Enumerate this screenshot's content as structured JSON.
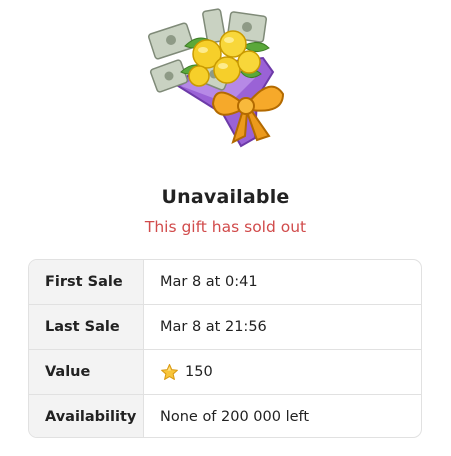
{
  "gift": {
    "icon": "money-flower-bouquet-icon",
    "title": "Unavailable",
    "status": "This gift has sold out"
  },
  "colors": {
    "status_text": "#d14b4b",
    "label_background": "#f3f3f3",
    "border": "#e1e1e1"
  },
  "details": {
    "rows": [
      {
        "label": "First Sale",
        "value": "Mar 8 at 0:41"
      },
      {
        "label": "Last Sale",
        "value": "Mar 8 at 21:56"
      },
      {
        "label": "Value",
        "value": "150",
        "icon": "star-icon"
      },
      {
        "label": "Availability",
        "value": "None of 200 000 left"
      }
    ]
  }
}
